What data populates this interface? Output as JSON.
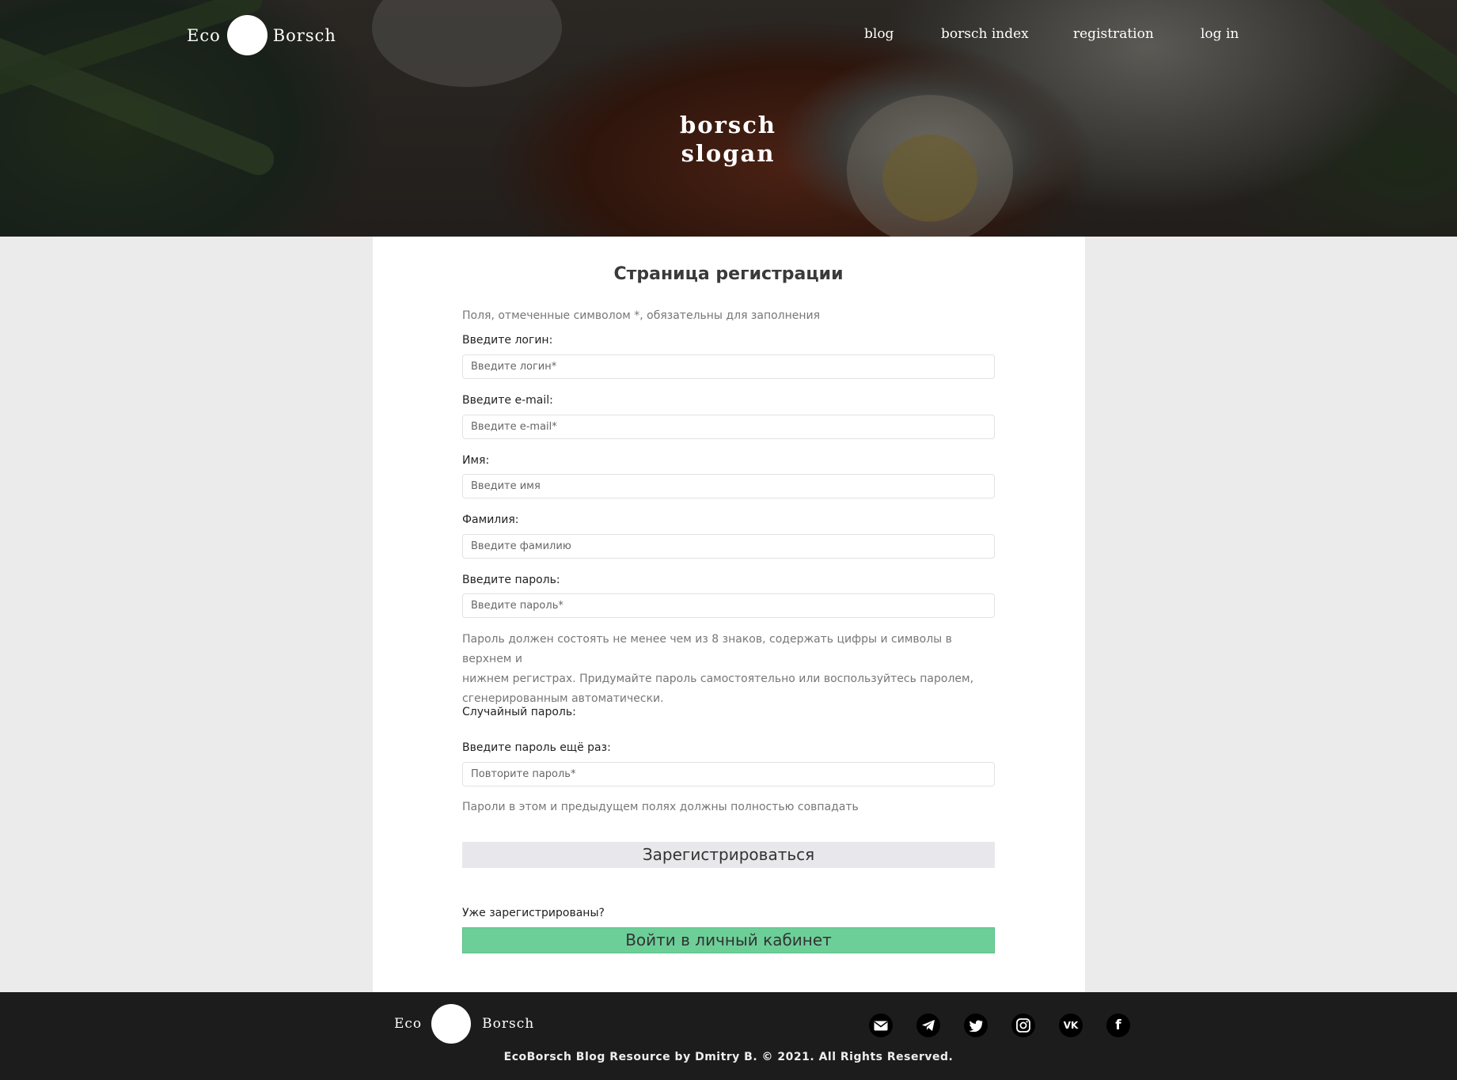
{
  "header": {
    "logo_left": "Eco",
    "logo_right": "Borsch",
    "nav": [
      "blog",
      "borsch index",
      "registration",
      "log in"
    ],
    "slogan_line1": "borsch",
    "slogan_line2": "slogan"
  },
  "form": {
    "title": "Страница регистрации",
    "required_note": "Поля, отмеченные символом *, обязательны для заполнения",
    "login_label": "Введите логин:",
    "login_placeholder": "Введите логин*",
    "email_label": "Введите e-mail:",
    "email_placeholder": "Введите e-mail*",
    "name_label": "Имя:",
    "name_placeholder": "Введите имя",
    "surname_label": "Фамилия:",
    "surname_placeholder": "Введите фамилию",
    "password_label": "Введите пароль:",
    "password_placeholder": "Введите пароль*",
    "password_hint_line1": "Пароль должен состоять не менее чем из 8 знаков, содержать цифры и символы в верхнем и",
    "password_hint_line2": "нижнем регистрах. Придумайте пароль самостоятельно или воспользуйтесь паролем,",
    "password_hint_line3": "сгенерированным автоматически.",
    "random_password_label": "Случайный пароль:",
    "repeat_label": "Введите пароль ещё раз:",
    "repeat_placeholder": "Повторите пароль*",
    "repeat_hint": "Пароли в этом и предыдущем полях должны полностью совпадать",
    "register_button": "Зарегистрироваться",
    "already_registered": "Уже зарегистрированы?",
    "login_button": "Войти в личный кабинет"
  },
  "footer": {
    "logo_left": "Eco",
    "logo_right": "Borsch",
    "social_icons": [
      "mail-icon",
      "telegram-icon",
      "twitter-icon",
      "instagram-icon",
      "vk-icon",
      "facebook-icon"
    ],
    "vk_glyph": "VK",
    "facebook_glyph": "f",
    "copyright": "EcoBorsch Blog Resource by Dmitry B. © 2021. All Rights Reserved."
  },
  "colors": {
    "login_button_bg": "#6dcf98",
    "register_button_bg": "#e8e8ec",
    "footer_bg": "#1c1c1c",
    "page_bg": "#ebebeb"
  }
}
